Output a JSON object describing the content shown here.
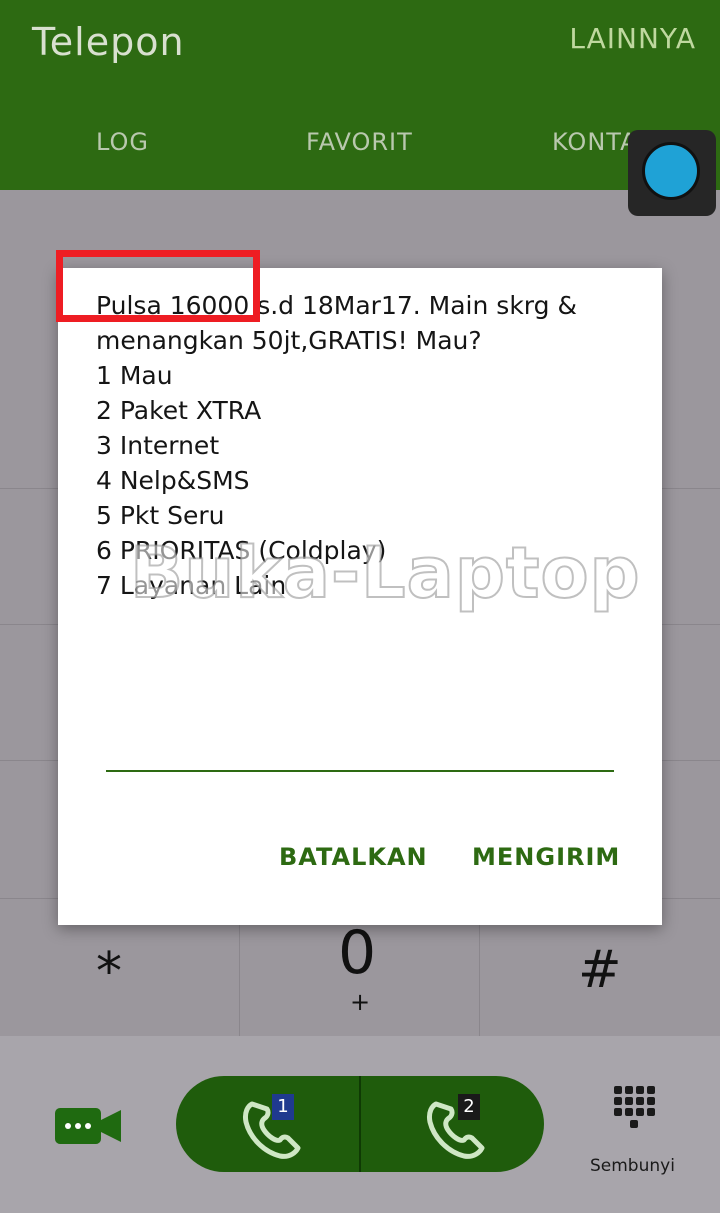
{
  "appbar": {
    "title": "Telepon",
    "more": "LAINNYA",
    "tabs": [
      "LOG",
      "FAVORIT",
      "KONTAK"
    ]
  },
  "dialpad": {
    "star": "*",
    "zero": "0",
    "zero_sub": "+",
    "hash": "#"
  },
  "bottom": {
    "sim1": "1",
    "sim2": "2",
    "hide_label": "Sembunyi"
  },
  "dialog": {
    "message": "Pulsa 16000 s.d 18Mar17. Main skrg & menangkan 50jt,GRATIS! Mau?\n1 Mau\n2 Paket XTRA\n3 Internet\n4 Nelp&SMS\n5 Pkt Seru\n6 PRIORITAS (Coldplay)\n7 Layanan Lain",
    "cancel": "BATALKAN",
    "send": "MENGIRIM"
  },
  "watermark": "Buka-Laptop",
  "colors": {
    "brand_green": "#2d6a12",
    "highlight_red": "#ee1d23",
    "bubble_blue": "#1fa2d6"
  }
}
